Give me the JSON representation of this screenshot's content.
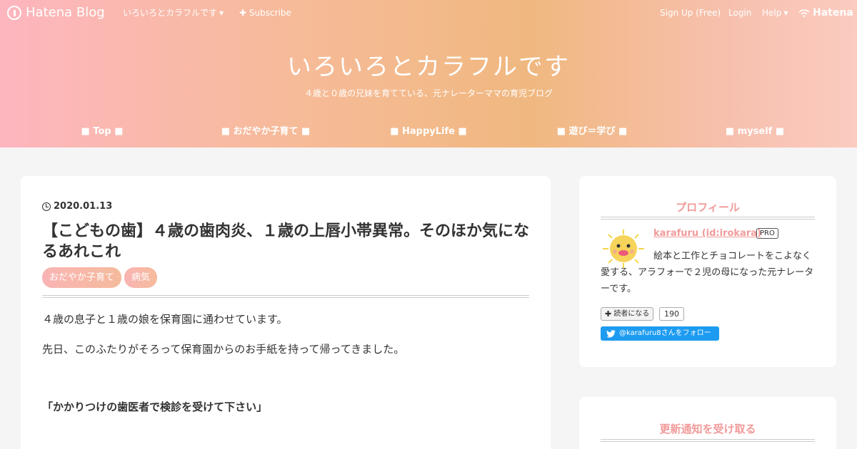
{
  "topbar": {
    "logo_text": "Hatena Blog",
    "blog_menu_label": "いろいろとカラフルです",
    "subscribe_label": "Subscribe",
    "signup_label": "Sign Up (Free)",
    "login_label": "Login",
    "help_label": "Help",
    "hatena_label": "Hatena"
  },
  "header": {
    "title": "いろいろとカラフルです",
    "description": "４歳と０歳の兄妹を育てている、元ナレーターママの育児ブログ"
  },
  "global_nav": [
    {
      "label": "■ Top ■"
    },
    {
      "label": "■ おだやか子育て ■"
    },
    {
      "label": "■ HappyLife ■"
    },
    {
      "label": "■ 遊び＝学び ■"
    },
    {
      "label": "■ myself ■"
    }
  ],
  "entry": {
    "date": "2020.01.13",
    "title": "【こどもの歯】４歳の歯肉炎、１歳の上唇小帯異常。そのほか気になるあれこれ",
    "categories": [
      "おだやか子育て",
      "病気"
    ],
    "paragraphs": [
      "４歳の息子と１歳の娘を保育園に通わせています。",
      "先日、このふたりがそろって保育園からのお手紙を持って帰ってきました。",
      "「かかりつけの歯医者で検診を受けて下さい」"
    ]
  },
  "sidebar": {
    "profile": {
      "heading": "プロフィール",
      "name": "karafuru (id:irokara)",
      "badge": "PRO",
      "bio": "絵本と工作とチョコレートをこよなく愛する、アラフォーで２児の母になった元ナレーターです。",
      "reader_button": "読者になる",
      "reader_count": "190",
      "twitter_button": "@karafuru8さんをフォロー"
    },
    "notify": {
      "heading": "更新通知を受け取る"
    }
  },
  "colors": {
    "accent_pink": "#f29a9a",
    "twitter_blue": "#1d9bf0"
  }
}
